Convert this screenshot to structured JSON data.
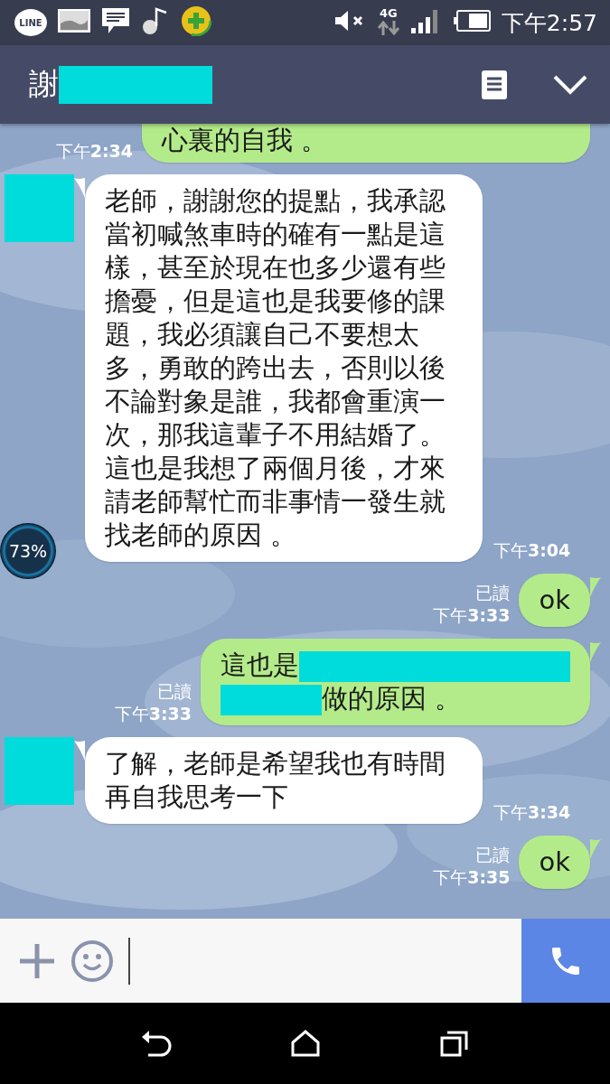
{
  "status_bar": {
    "app_badge": "LINE",
    "network": "4G",
    "time": "下午2:57"
  },
  "header": {
    "title": "謝"
  },
  "messages": [
    {
      "kind": "sent",
      "time": "下午**2:34**",
      "segments": [
        {
          "kind": "text",
          "text": "心裏的自我 。"
        }
      ]
    },
    {
      "kind": "received",
      "time": "下午**3:04**",
      "segments": [
        {
          "kind": "text",
          "text": "老師，謝謝您的提點，我承認當初喊煞車時的確有一點是這樣，甚至於現在也多少還有些擔憂，但是這也是我要修的課題，我必須讓自己不要想太多，勇敢的跨出去，否則以後不論對象是誰，我都會重演一次，那我這輩子不用結婚了。這也是我想了兩個月後，才來請老師幫忙而非事情一發生就找老師的原因 。"
        }
      ]
    },
    {
      "kind": "sent",
      "read_label": "已讀",
      "time": "下午**3:33**",
      "segments": [
        {
          "kind": "text",
          "text": "ok"
        }
      ]
    },
    {
      "kind": "sent",
      "read_label": "已讀",
      "time": "下午**3:33**",
      "segments": [
        {
          "kind": "text",
          "text": "這也是"
        },
        {
          "kind": "redaction"
        },
        {
          "kind": "break"
        },
        {
          "kind": "redaction"
        },
        {
          "kind": "text",
          "text": "做的原因 。"
        }
      ]
    },
    {
      "kind": "received",
      "time": "下午**3:34**",
      "segments": [
        {
          "kind": "text",
          "text": "了解，老師是希望我也有時間再自我思考一下"
        }
      ]
    },
    {
      "kind": "sent",
      "read_label": "已讀",
      "time": "下午**3:35**",
      "segments": [
        {
          "kind": "text",
          "text": "ok"
        }
      ]
    }
  ],
  "floating_widget": {
    "reading": "73%"
  }
}
